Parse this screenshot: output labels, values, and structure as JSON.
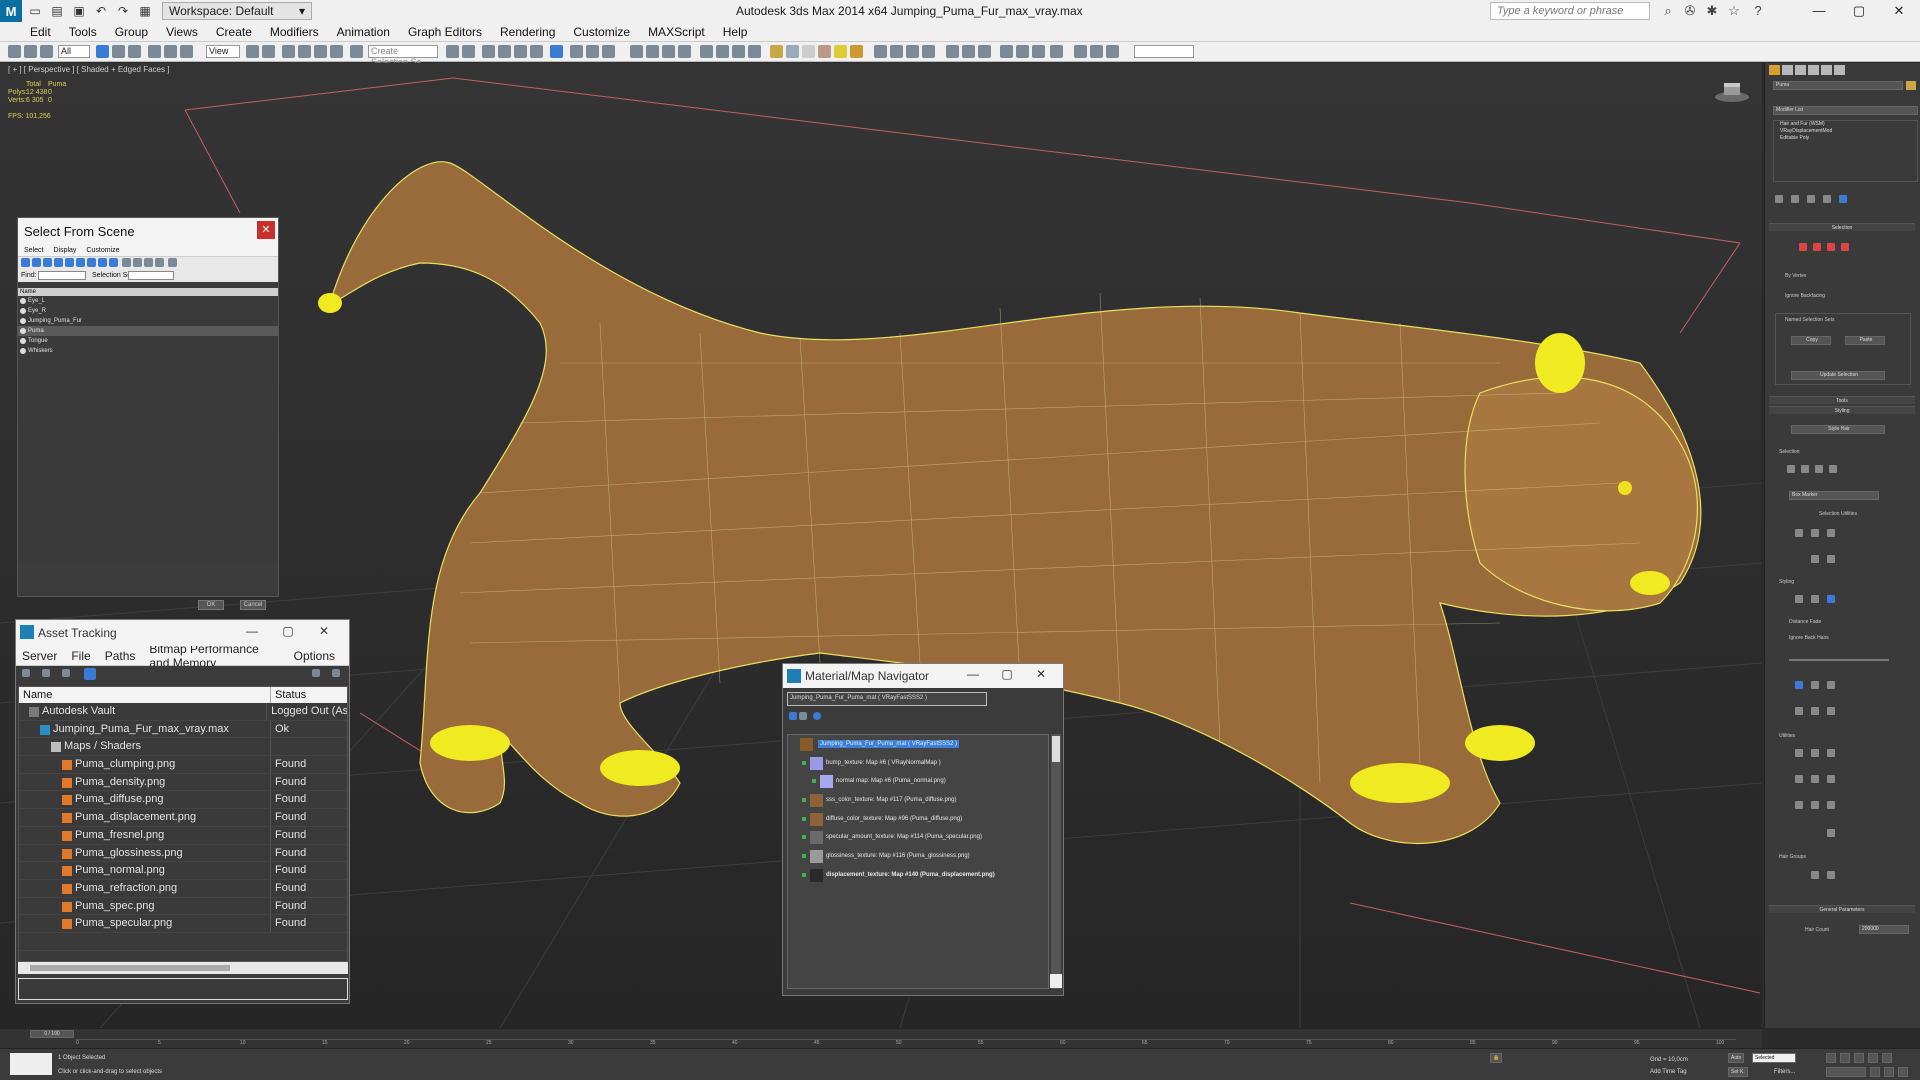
{
  "titlebar": {
    "workspace": "Workspace: Default",
    "title": "Autodesk 3ds Max  2014 x64      Jumping_Puma_Fur_max_vray.max",
    "search_placeholder": "Type a keyword or phrase"
  },
  "menu": [
    "Edit",
    "Tools",
    "Group",
    "Views",
    "Create",
    "Modifiers",
    "Animation",
    "Graph Editors",
    "Rendering",
    "Customize",
    "MAXScript",
    "Help"
  ],
  "toolbar": {
    "filter_value": "All",
    "view_value": "View",
    "selection_set_placeholder": "Create Selection Se"
  },
  "viewport": {
    "label": "[ + ] [ Perspective ] [ Shaded + Edged Faces ]",
    "stats": {
      "col_total": "Total",
      "col_object": "Puma",
      "polys_label": "Polys:",
      "polys_total": "12 438",
      "polys_object": "0",
      "verts_label": "Verts:",
      "verts_total": "6 305",
      "verts_object": "0"
    },
    "fps_label": "FPS:",
    "fps_value": "101,256"
  },
  "select_from_scene": {
    "title": "Select From Scene",
    "menu": [
      "Select",
      "Display",
      "Customize"
    ],
    "find_label": "Find:",
    "selection_set_label": "Selection Set:",
    "column_name": "Name",
    "items": [
      "Eye_L",
      "Eye_R",
      "Jumping_Puma_Fur",
      "Puma",
      "Tongue",
      "Whiskers"
    ],
    "selected_index": 3,
    "ok": "OK",
    "cancel": "Cancel"
  },
  "asset_tracking": {
    "title": "Asset Tracking",
    "menu": [
      "Server",
      "File",
      "Paths",
      "Bitmap Performance and Memory",
      "Options"
    ],
    "col_name": "Name",
    "col_status": "Status",
    "rows": [
      {
        "name": "Autodesk Vault",
        "status": "Logged Out (As",
        "indent": 1,
        "icon": "vault-icon"
      },
      {
        "name": "Jumping_Puma_Fur_max_vray.max",
        "status": "Ok",
        "indent": 2,
        "icon": "max-file-icon"
      },
      {
        "name": "Maps / Shaders",
        "status": "",
        "indent": 3,
        "icon": "folder-icon"
      },
      {
        "name": "Puma_clumping.png",
        "status": "Found",
        "indent": 4,
        "icon": "image-file-icon"
      },
      {
        "name": "Puma_density.png",
        "status": "Found",
        "indent": 4,
        "icon": "image-file-icon"
      },
      {
        "name": "Puma_diffuse.png",
        "status": "Found",
        "indent": 4,
        "icon": "image-file-icon"
      },
      {
        "name": "Puma_displacement.png",
        "status": "Found",
        "indent": 4,
        "icon": "image-file-icon"
      },
      {
        "name": "Puma_fresnel.png",
        "status": "Found",
        "indent": 4,
        "icon": "image-file-icon"
      },
      {
        "name": "Puma_glossiness.png",
        "status": "Found",
        "indent": 4,
        "icon": "image-file-icon"
      },
      {
        "name": "Puma_normal.png",
        "status": "Found",
        "indent": 4,
        "icon": "image-file-icon"
      },
      {
        "name": "Puma_refraction.png",
        "status": "Found",
        "indent": 4,
        "icon": "image-file-icon"
      },
      {
        "name": "Puma_spec.png",
        "status": "Found",
        "indent": 4,
        "icon": "image-file-icon"
      },
      {
        "name": "Puma_specular.png",
        "status": "Found",
        "indent": 4,
        "icon": "image-file-icon"
      }
    ]
  },
  "material_navigator": {
    "title": "Material/Map Navigator",
    "field_value": "Jumping_Puma_Fur_Puma_mat  ( VRayFastSSS2 )",
    "items": [
      {
        "text": "Jumping_Puma_Fur_Puma_mat  ( VRayFastSSS2 )",
        "thumb": "#8a5a2b",
        "level": 0,
        "bold": false
      },
      {
        "text": "bump_texture: Map #6  ( VRayNormalMap )",
        "thumb": "#9a9ae6",
        "level": 1,
        "bold": false
      },
      {
        "text": "normal map: Map #6 (Puma_normal.png)",
        "thumb": "#a7a7f0",
        "level": 2,
        "bold": false
      },
      {
        "text": "sss_color_texture: Map #117 (Puma_diffuse.png)",
        "thumb": "#8e6238",
        "level": 1,
        "bold": false
      },
      {
        "text": "diffuse_color_texture: Map #96 (Puma_diffuse.png)",
        "thumb": "#8e6238",
        "level": 1,
        "bold": false
      },
      {
        "text": "specular_amount_texture: Map #114 (Puma_specular.png)",
        "thumb": "#6a6a6a",
        "level": 1,
        "bold": false
      },
      {
        "text": "glossiness_texture: Map #116 (Puma_glossiness.png)",
        "thumb": "#9a9a9a",
        "level": 1,
        "bold": false
      },
      {
        "text": "displacement_texture: Map #140 (Puma_displacement.png)",
        "thumb": "#2a2a2a",
        "level": 1,
        "bold": true
      }
    ]
  },
  "command_panel": {
    "object_name": "Puma",
    "modifier_list_label": "Modifier List",
    "modifiers": [
      "Hair and Fur (WSM)",
      "VRayDisplacementMod",
      "Editable Poly"
    ],
    "rollouts": {
      "selection": "Selection",
      "tools": "Tools",
      "styling": "Styling",
      "general": "General Parameters"
    },
    "labels": {
      "by_vertex": "By Vertex",
      "ignore_backfacing": "Ignore Backfacing",
      "named_sel": "Named Selection Sets",
      "copy": "Copy",
      "paste": "Paste",
      "update_selection": "Update Selection",
      "style_hair": "Style Hair",
      "selection": "Selection",
      "hair_marker": "Box Marker",
      "selection_utilities": "Selection Utilities",
      "styling": "Styling",
      "distance_fade": "Distance Fade",
      "ignore_back_hairs": "Ignore Back Hairs",
      "utilities": "Utilities",
      "hair_groups": "Hair Groups",
      "hair_count_label": "Hair Count",
      "hair_count_value": "200000"
    }
  },
  "timeline": {
    "frame": "0 / 100",
    "ticks": [
      "0",
      "5",
      "10",
      "15",
      "20",
      "25",
      "30",
      "35",
      "40",
      "45",
      "50",
      "55",
      "60",
      "65",
      "70",
      "75",
      "80",
      "85",
      "90",
      "95",
      "100"
    ]
  },
  "status": {
    "selected": "1 Object Selected",
    "prompt": "Click or click-and-drag to select objects",
    "grid": "Grid = 10,0cm",
    "auto": "Auto",
    "set_key": "Set K.",
    "selected_dropdown": "Selected",
    "add_time_tag": "Add Time Tag",
    "key_filters": "Filters..."
  }
}
